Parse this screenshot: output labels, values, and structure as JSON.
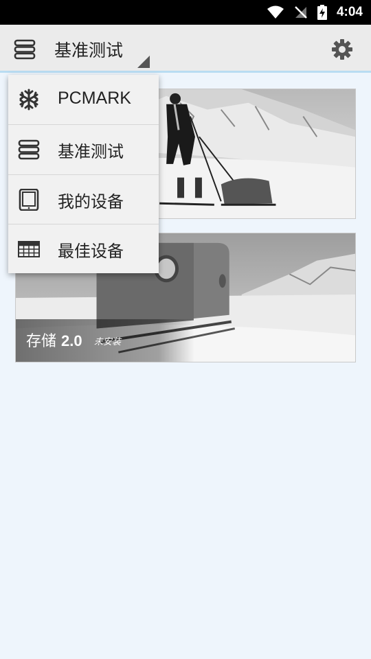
{
  "status_bar": {
    "time": "4:04"
  },
  "app_bar": {
    "title": "基准测试"
  },
  "menu": {
    "items": [
      {
        "label": "PCMARK",
        "icon": "snowflake-icon"
      },
      {
        "label": "基准测试",
        "icon": "stack-icon"
      },
      {
        "label": "我的设备",
        "icon": "tablet-icon"
      },
      {
        "label": "最佳设备",
        "icon": "grid-icon"
      }
    ]
  },
  "cards": [
    {
      "name": "",
      "version": "",
      "status": ""
    },
    {
      "name": "存储",
      "version": "2.0",
      "status": "未安装"
    }
  ]
}
